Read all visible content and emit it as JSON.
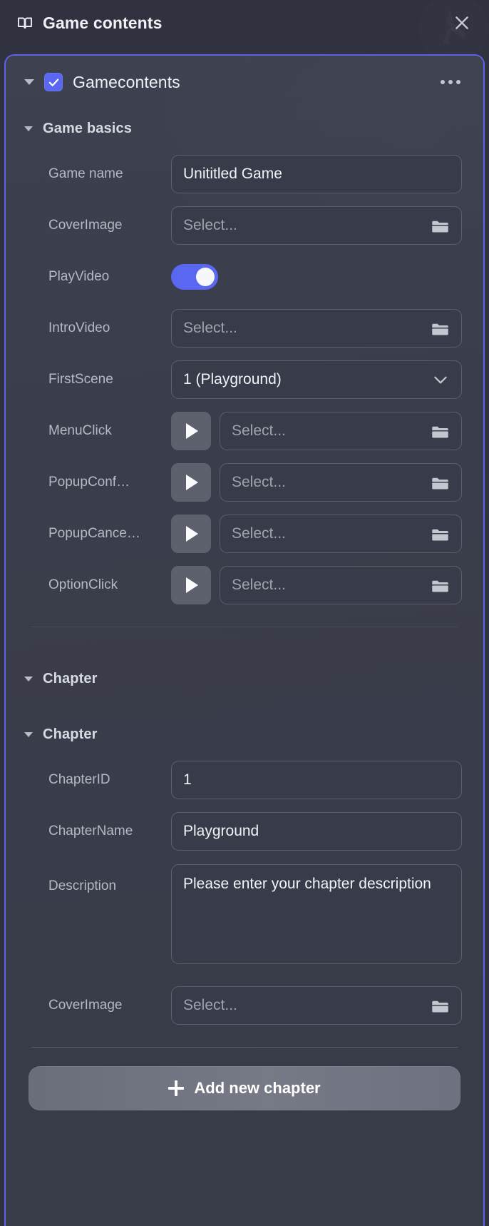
{
  "window": {
    "title": "Game contents",
    "title_icon": "book-icon",
    "close_icon": "close-icon"
  },
  "node": {
    "label": "Gamecontents",
    "checked": true,
    "expanded": true,
    "more_icon": "more-options-icon"
  },
  "groups": [
    {
      "id": "game-basics",
      "title": "Game basics",
      "expanded": true,
      "fields": [
        {
          "id": "game-name",
          "label": "Game name",
          "type": "text",
          "value": "Unititled Game",
          "placeholder": ""
        },
        {
          "id": "cover-image",
          "label": "CoverImage",
          "type": "file",
          "value": "",
          "placeholder": "Select...",
          "trailing_icon": "folder-icon"
        },
        {
          "id": "play-video",
          "label": "PlayVideo",
          "type": "toggle",
          "value": true
        },
        {
          "id": "intro-video",
          "label": "IntroVideo",
          "type": "file",
          "value": "",
          "placeholder": "Select...",
          "trailing_icon": "folder-icon"
        },
        {
          "id": "first-scene",
          "label": "FirstScene",
          "type": "select",
          "value": "1 (Playground)",
          "trailing_icon": "chevron-down-icon"
        },
        {
          "id": "menu-click",
          "label": "MenuClick",
          "type": "audio",
          "value": "",
          "placeholder": "Select...",
          "play_icon": "play-icon",
          "trailing_icon": "folder-icon"
        },
        {
          "id": "popup-confirm",
          "label": "PopupConf…",
          "type": "audio",
          "value": "",
          "placeholder": "Select...",
          "play_icon": "play-icon",
          "trailing_icon": "folder-icon"
        },
        {
          "id": "popup-cancel",
          "label": "PopupCance…",
          "type": "audio",
          "value": "",
          "placeholder": "Select...",
          "play_icon": "play-icon",
          "trailing_icon": "folder-icon"
        },
        {
          "id": "option-click",
          "label": "OptionClick",
          "type": "audio",
          "value": "",
          "placeholder": "Select...",
          "play_icon": "play-icon",
          "trailing_icon": "folder-icon"
        }
      ]
    },
    {
      "id": "chapter-section",
      "title": "Chapter",
      "expanded": true,
      "fields": []
    },
    {
      "id": "chapter",
      "title": "Chapter",
      "expanded": true,
      "fields": [
        {
          "id": "chapter-id",
          "label": "ChapterID",
          "type": "text",
          "value": "1",
          "placeholder": ""
        },
        {
          "id": "chapter-name",
          "label": "ChapterName",
          "type": "text",
          "value": "Playground",
          "placeholder": ""
        },
        {
          "id": "description",
          "label": "Description",
          "type": "textarea",
          "value": "Please enter your chapter description",
          "placeholder": ""
        },
        {
          "id": "chapter-cover",
          "label": "CoverImage",
          "type": "file",
          "value": "",
          "placeholder": "Select...",
          "trailing_icon": "folder-icon"
        }
      ]
    }
  ],
  "footer": {
    "add_chapter_label": "Add new chapter",
    "add_icon": "plus-icon"
  },
  "colors": {
    "accent": "#5a67f0",
    "panel_border": "#5c63ee",
    "background": "#30333f",
    "field_bg": "#383b49",
    "field_border": "#5b5f6d",
    "text_primary": "#f2f3f7",
    "text_secondary": "#b6b9c4",
    "placeholder": "#a0a3ae",
    "play_button_bg": "#5d606d",
    "add_button_bg": "#72757f"
  }
}
